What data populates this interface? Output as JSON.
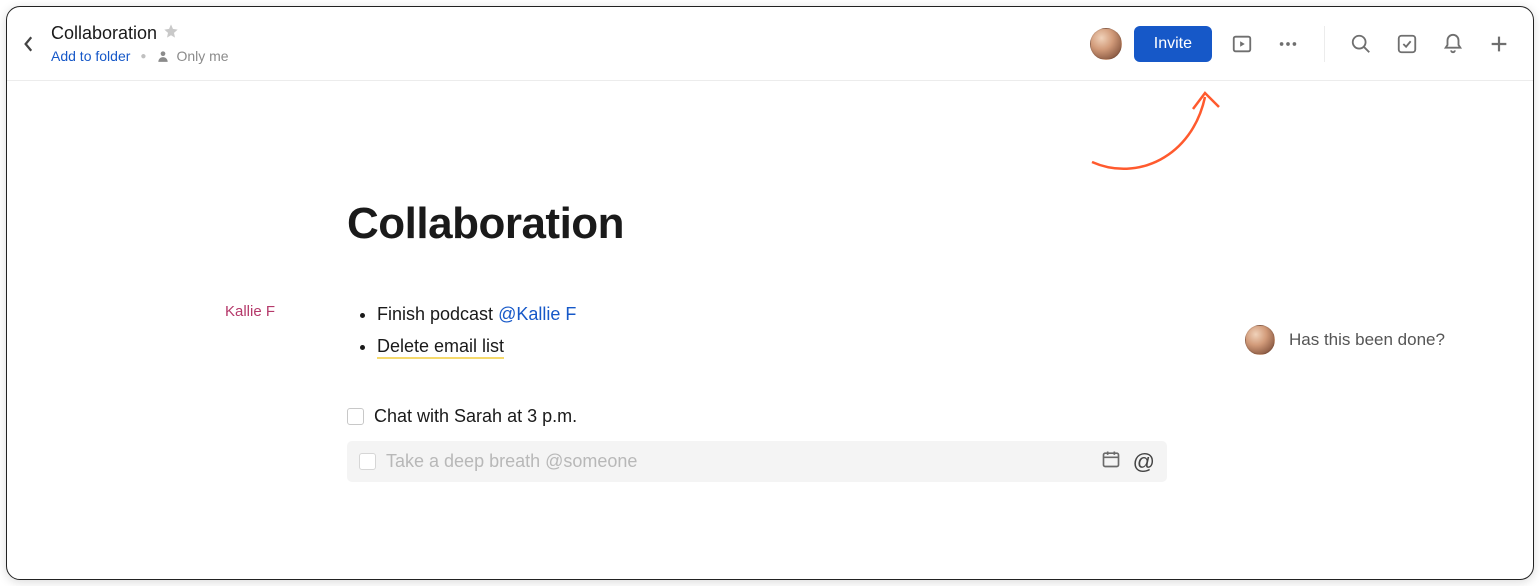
{
  "header": {
    "title": "Collaboration",
    "add_to_folder": "Add to folder",
    "privacy": "Only me",
    "invite_label": "Invite"
  },
  "document": {
    "heading": "Collaboration",
    "bullets": [
      {
        "text": "Finish podcast ",
        "mention": "@Kallie F"
      },
      {
        "text": "Delete email list"
      }
    ],
    "margin_author": "Kallie F",
    "task": "Chat with Sarah at 3 p.m.",
    "new_task_placeholder": "Take a deep breath @someone"
  },
  "comment": {
    "text": "Has this been done?"
  }
}
